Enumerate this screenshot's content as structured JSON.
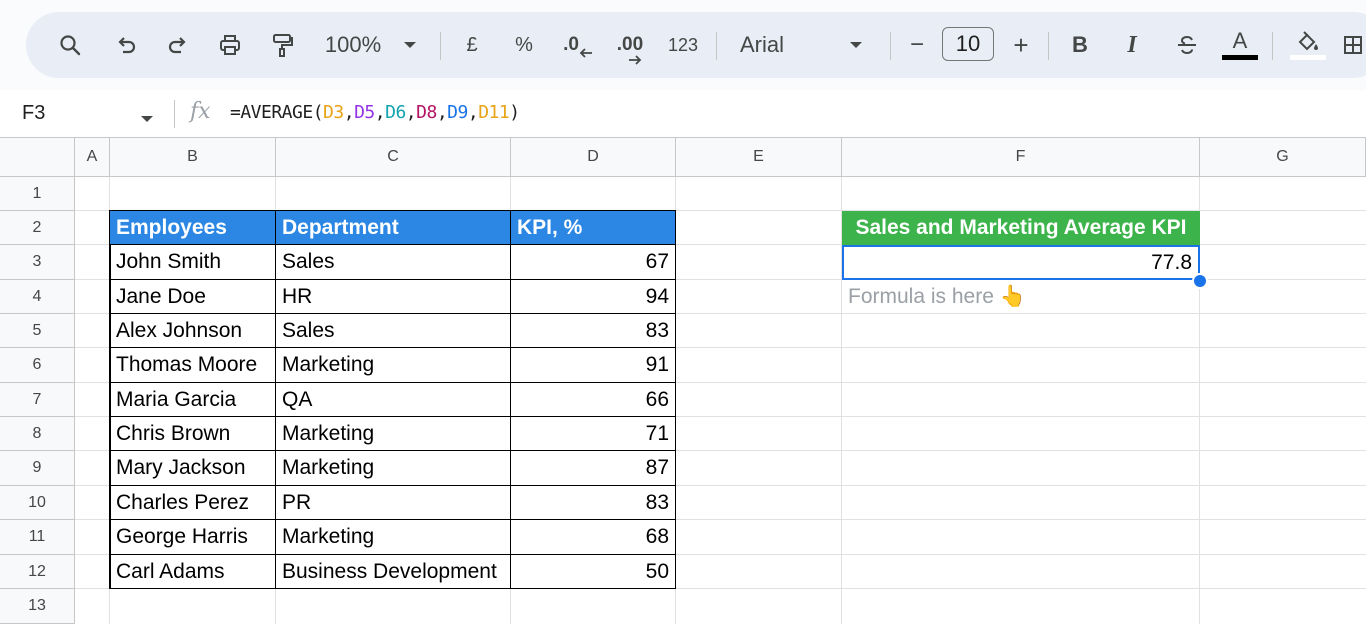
{
  "toolbar": {
    "zoom": "100%",
    "currency": "£",
    "percent": "%",
    "decrease_decimal": ".0",
    "increase_decimal": ".00",
    "more_formats": "123",
    "font": "Arial",
    "font_size": "10",
    "minus": "−",
    "plus": "+",
    "bold": "B",
    "italic": "I",
    "text_color_label": "A"
  },
  "formula_bar": {
    "name_box": "F3",
    "fx": "fx",
    "formula_prefix": "=AVERAGE(",
    "refs": [
      "D3",
      "D5",
      "D6",
      "D8",
      "D9",
      "D11"
    ],
    "sep": ",",
    "formula_suffix": ")"
  },
  "columns": [
    "A",
    "B",
    "C",
    "D",
    "E",
    "F",
    "G"
  ],
  "rows": [
    "1",
    "2",
    "3",
    "4",
    "5",
    "6",
    "7",
    "8",
    "9",
    "10",
    "11",
    "12",
    "13"
  ],
  "table": {
    "headers": [
      "Employees",
      "Department",
      "KPI, %"
    ],
    "rows": [
      {
        "employee": "John Smith",
        "department": "Sales",
        "kpi": "67"
      },
      {
        "employee": "Jane Doe",
        "department": "HR",
        "kpi": "94"
      },
      {
        "employee": "Alex Johnson",
        "department": "Sales",
        "kpi": "83"
      },
      {
        "employee": "Thomas Moore",
        "department": "Marketing",
        "kpi": "91"
      },
      {
        "employee": "Maria Garcia",
        "department": "QA",
        "kpi": "66"
      },
      {
        "employee": "Chris Brown",
        "department": "Marketing",
        "kpi": "71"
      },
      {
        "employee": "Mary Jackson",
        "department": "Marketing",
        "kpi": "87"
      },
      {
        "employee": "Charles Perez",
        "department": "PR",
        "kpi": "83"
      },
      {
        "employee": "George Harris",
        "department": "Marketing",
        "kpi": "68"
      },
      {
        "employee": "Carl Adams",
        "department": "Business Development",
        "kpi": "50"
      }
    ]
  },
  "summary": {
    "header": "Sales and Marketing Average KPI",
    "value": "77.8",
    "note": "Formula is here 👆"
  },
  "colors": {
    "header_blue": "#2b87e3",
    "header_green": "#3cb44b",
    "selection": "#1a73e8"
  }
}
